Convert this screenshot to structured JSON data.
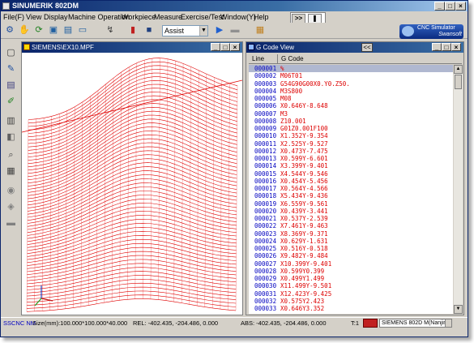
{
  "window": {
    "title": "SINUMERIK 802DM"
  },
  "menu": [
    "File(F)",
    "View",
    "Display",
    "Machine Operation",
    "Workpiece",
    "Measure",
    "Exercise/Test",
    "Window(Y)",
    "Help"
  ],
  "toolbar": {
    "mode_value": "Assist"
  },
  "sim_controls": {
    "step": ">>",
    "pause": "❚"
  },
  "logo": {
    "line1": "CNC Simulator",
    "line2": "Swansoft"
  },
  "viewport": {
    "title": "SIEMENS\\EX10.MPF"
  },
  "gcode": {
    "title": "G Code View",
    "back_button": "<<",
    "columns": [
      "Line",
      "G Code"
    ],
    "rows": [
      {
        "line": "000001",
        "code": "%"
      },
      {
        "line": "000002",
        "code": "M06T01"
      },
      {
        "line": "000003",
        "code": "G54G90G00X0.Y0.Z50."
      },
      {
        "line": "000004",
        "code": "M3S800"
      },
      {
        "line": "000005",
        "code": "M08"
      },
      {
        "line": "000006",
        "code": "X0.646Y-8.648"
      },
      {
        "line": "000007",
        "code": "M3"
      },
      {
        "line": "000008",
        "code": "Z10.001"
      },
      {
        "line": "000009",
        "code": "G01Z0.001F100"
      },
      {
        "line": "000010",
        "code": "X1.352Y-9.354"
      },
      {
        "line": "000011",
        "code": "X2.525Y-9.527"
      },
      {
        "line": "000012",
        "code": "X0.473Y-7.475"
      },
      {
        "line": "000013",
        "code": "X0.599Y-6.601"
      },
      {
        "line": "000014",
        "code": "X3.399Y-9.401"
      },
      {
        "line": "000015",
        "code": "X4.544Y-9.546"
      },
      {
        "line": "000016",
        "code": "X0.454Y-5.456"
      },
      {
        "line": "000017",
        "code": "X0.564Y-4.566"
      },
      {
        "line": "000018",
        "code": "X5.434Y-9.436"
      },
      {
        "line": "000019",
        "code": "X6.559Y-9.561"
      },
      {
        "line": "000020",
        "code": "X0.439Y-3.441"
      },
      {
        "line": "000021",
        "code": "X0.537Y-2.539"
      },
      {
        "line": "000022",
        "code": "X7.461Y-9.463"
      },
      {
        "line": "000023",
        "code": "X8.369Y-9.371"
      },
      {
        "line": "000024",
        "code": "X0.629Y-1.631"
      },
      {
        "line": "000025",
        "code": "X0.516Y-0.518"
      },
      {
        "line": "000026",
        "code": "X9.482Y-9.484"
      },
      {
        "line": "000027",
        "code": "X10.399Y-9.401"
      },
      {
        "line": "000028",
        "code": "X0.599Y0.399"
      },
      {
        "line": "000029",
        "code": "X0.499Y1.499"
      },
      {
        "line": "000030",
        "code": "X11.499Y-9.501"
      },
      {
        "line": "000031",
        "code": "X12.423Y-9.425"
      },
      {
        "line": "000032",
        "code": "X0.575Y2.423"
      },
      {
        "line": "000033",
        "code": "X0.646Y3.352"
      }
    ]
  },
  "status": {
    "mode": "SSCNC NM",
    "size": "Size(mm):100.000*100.000*40.000",
    "rel": "REL: -402.435, -204.486,  0.000",
    "abs": "ABS: -402.435, -204.486,  0.000",
    "tool": "T:1",
    "controller": "SIEMENS 802D M(Nanjin"
  },
  "colors": {
    "accent_title": "#0a246a",
    "toolpath": "#e00000",
    "line_numbers": "#0000c0"
  }
}
